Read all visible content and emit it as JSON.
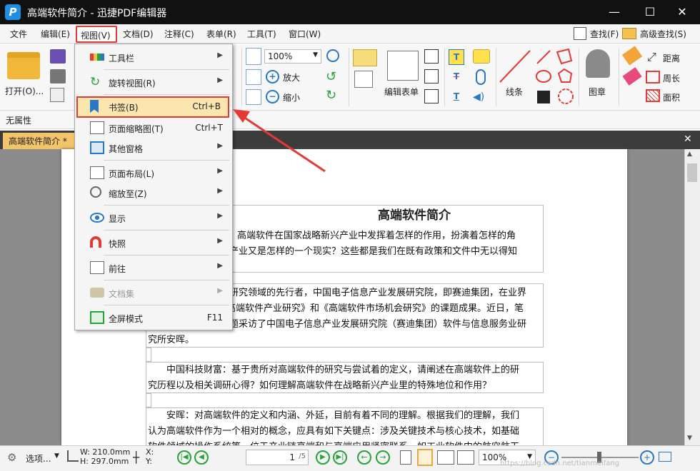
{
  "window": {
    "title": "高端软件简介 - 迅捷PDF编辑器",
    "logo_letter": "P",
    "min": "—",
    "max": "☐",
    "close": "✕"
  },
  "menubar": {
    "items": [
      "文件",
      "编辑(E)",
      "视图(V)",
      "文档(D)",
      "注释(C)",
      "表单(R)",
      "工具(T)",
      "窗口(W)"
    ],
    "find": "查找(F)",
    "advanced_find": "高级查找(S)"
  },
  "toolbar": {
    "open": "打开(O)...",
    "zoom_value": "100%",
    "zoom_in": "放大",
    "zoom_out": "缩小",
    "edit_form": "编辑表单",
    "line": "线条",
    "stamp": "图章",
    "distance": "距离",
    "perimeter": "周长",
    "area": "面积"
  },
  "props": {
    "text": "无属性"
  },
  "tab": {
    "name": "高端软件简介 *",
    "close": "✕"
  },
  "view_menu": {
    "items": [
      {
        "label": "工具栏",
        "shortcut": "",
        "submenu": true,
        "disabled": false,
        "icon": "toolbar-icon"
      },
      {
        "label": "旋转视图(R)",
        "shortcut": "",
        "submenu": true,
        "disabled": false,
        "icon": "rotate-icon"
      },
      {
        "label": "书签(B)",
        "shortcut": "Ctrl+B",
        "submenu": false,
        "disabled": false,
        "icon": "bookmark-icon"
      },
      {
        "label": "页面缩略图(T)",
        "shortcut": "Ctrl+T",
        "submenu": false,
        "disabled": false,
        "icon": "thumbnail-icon"
      },
      {
        "label": "其他窗格",
        "shortcut": "",
        "submenu": true,
        "disabled": false,
        "icon": "panes-icon"
      },
      {
        "label": "页面布局(L)",
        "shortcut": "",
        "submenu": true,
        "disabled": false,
        "icon": "layout-icon"
      },
      {
        "label": "缩放至(Z)",
        "shortcut": "",
        "submenu": true,
        "disabled": false,
        "icon": "zoom-icon"
      },
      {
        "label": "显示",
        "shortcut": "",
        "submenu": true,
        "disabled": false,
        "icon": "eye-icon"
      },
      {
        "label": "快照",
        "shortcut": "",
        "submenu": true,
        "disabled": false,
        "icon": "magnet-icon"
      },
      {
        "label": "前往",
        "shortcut": "",
        "submenu": true,
        "disabled": false,
        "icon": "goto-icon"
      },
      {
        "label": "文档集",
        "shortcut": "",
        "submenu": true,
        "disabled": true,
        "icon": "briefcase-icon"
      },
      {
        "label": "全屏模式",
        "shortcut": "F11",
        "submenu": false,
        "disabled": false,
        "icon": "fullscreen-icon"
      }
    ]
  },
  "document": {
    "title": "高端软件简介",
    "p1_line1": "高端软件在国家战略新兴产业中发挥着怎样的作用，扮演着怎样的角",
    "p1_line2": "产业又是怎样的一个现实？这些都是我们在既有政策和文件中无以得知",
    "p2_line1": "研究领域的先行者，中国电子信息产业发展研究院，即赛迪集团，在业界",
    "p2_line2": "高端软件产业研究》和《高端软件市场机会研究》的课题成果。近日，笔",
    "p2_line3": "题采访了中国电子信息产业发展研究院（赛迪集团）软件与信息服务业研",
    "p2_line4": "究所安晖。",
    "p3_line1": "中国科技财富：基于贵所对高端软件的研究与尝试着的定义，请阐述在高端软件上的研",
    "p3_line2": "究历程以及相关调研心得？如何理解高端软件在战略新兴产业里的特殊地位和作用？",
    "p4_line1": "安晖：对高端软件的定义和内涵、外延，目前有着不同的理解。根据我们的理解，我们",
    "p4_line2": "认为高端软件作为一个相对的概念，应具有如下关键点：涉及关键技术与核心技术，如基础",
    "p4_line3": "软件领域的操作系统等，位于产业链高端和与高端应用紧密联系。如工业软件中的航空航天"
  },
  "statusbar": {
    "options": "选项...",
    "width": "W: 210.0mm",
    "height": "H: 297.0mm",
    "x": "X:",
    "y": "Y:",
    "page": "1",
    "page_total": "/5",
    "zoom": "100%",
    "watermark": "https://blog.csdn.net/tianmeifang"
  }
}
